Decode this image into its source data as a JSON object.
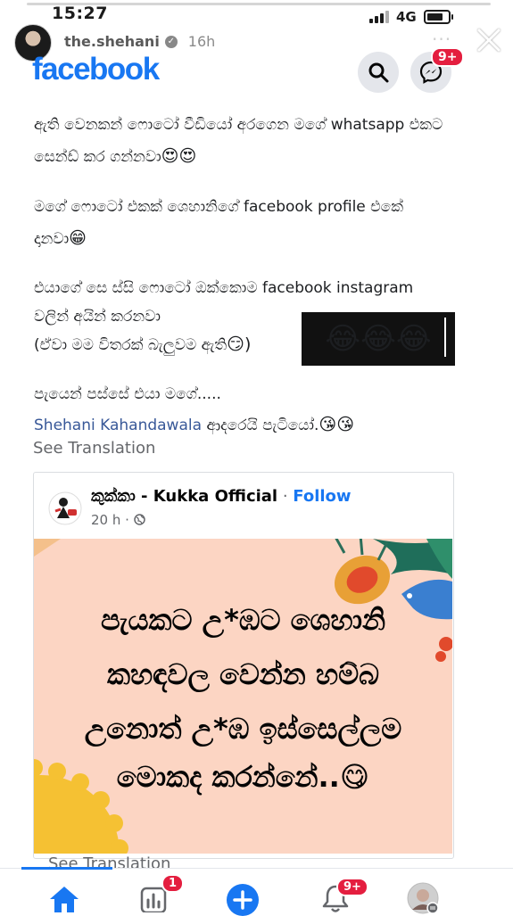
{
  "status_bar": {
    "time": "15:27",
    "network": "4G"
  },
  "story": {
    "username": "the.shehani",
    "age": "16h",
    "more": "···"
  },
  "facebook": {
    "logo": "facebook",
    "messenger_badge": "9+"
  },
  "post": {
    "lines": [
      "ඇති වෙනකන් ෆොටෝ වීඩියෝ අරගෙන මගේ whatsapp එකට",
      "සෙන්ඩ් කර ගන්නවා",
      "මගේ ෆොටෝ එකක් ශෙහානිගේ facebook profile එකේ",
      "දානවා",
      "එයාගේ සෙ ස්සි ෆොටෝ ඔක්කොම facebook instagram",
      "වලින් අයින් කරනවා",
      "(ඒවා මම විතරක් බැලුවම ඇති",
      "පැයෙන් පස්සේ එයා මගේ.....",
      "ආදරෙයි පැටියෝ."
    ],
    "emojis": {
      "line2": "😍😍",
      "line4": "😁",
      "line7": "😏)",
      "line9": "😘😘",
      "laugh": "😂😂😂"
    },
    "mention": "Shehani Kahandawala",
    "see_translation": "See Translation"
  },
  "shared_post": {
    "page_name": "කුක්කා - Kukka Official",
    "separator": " · ",
    "follow": "Follow",
    "time": "20 h · ",
    "meme_lines": [
      "පැයකට උ*ඹට ශෙහානි",
      "කහඳවල වෙන්න හම්බ",
      "උනොත් උ*ඹ ඉස්සෙල්ලම",
      "මොකද කරන්නේ.."
    ],
    "meme_emoji": "😋",
    "meme_colors": {
      "background": "#fcd5c3",
      "sun": "#f5c133",
      "flower": "#e8a036",
      "bird": "#3a7fd0"
    }
  },
  "bottom": {
    "see_translation": "See Translation",
    "notifications_badge": "1",
    "bell_badge": "9+"
  },
  "colors": {
    "brand": "#1877f2",
    "badge": "#e41e3f",
    "link": "#385898"
  }
}
